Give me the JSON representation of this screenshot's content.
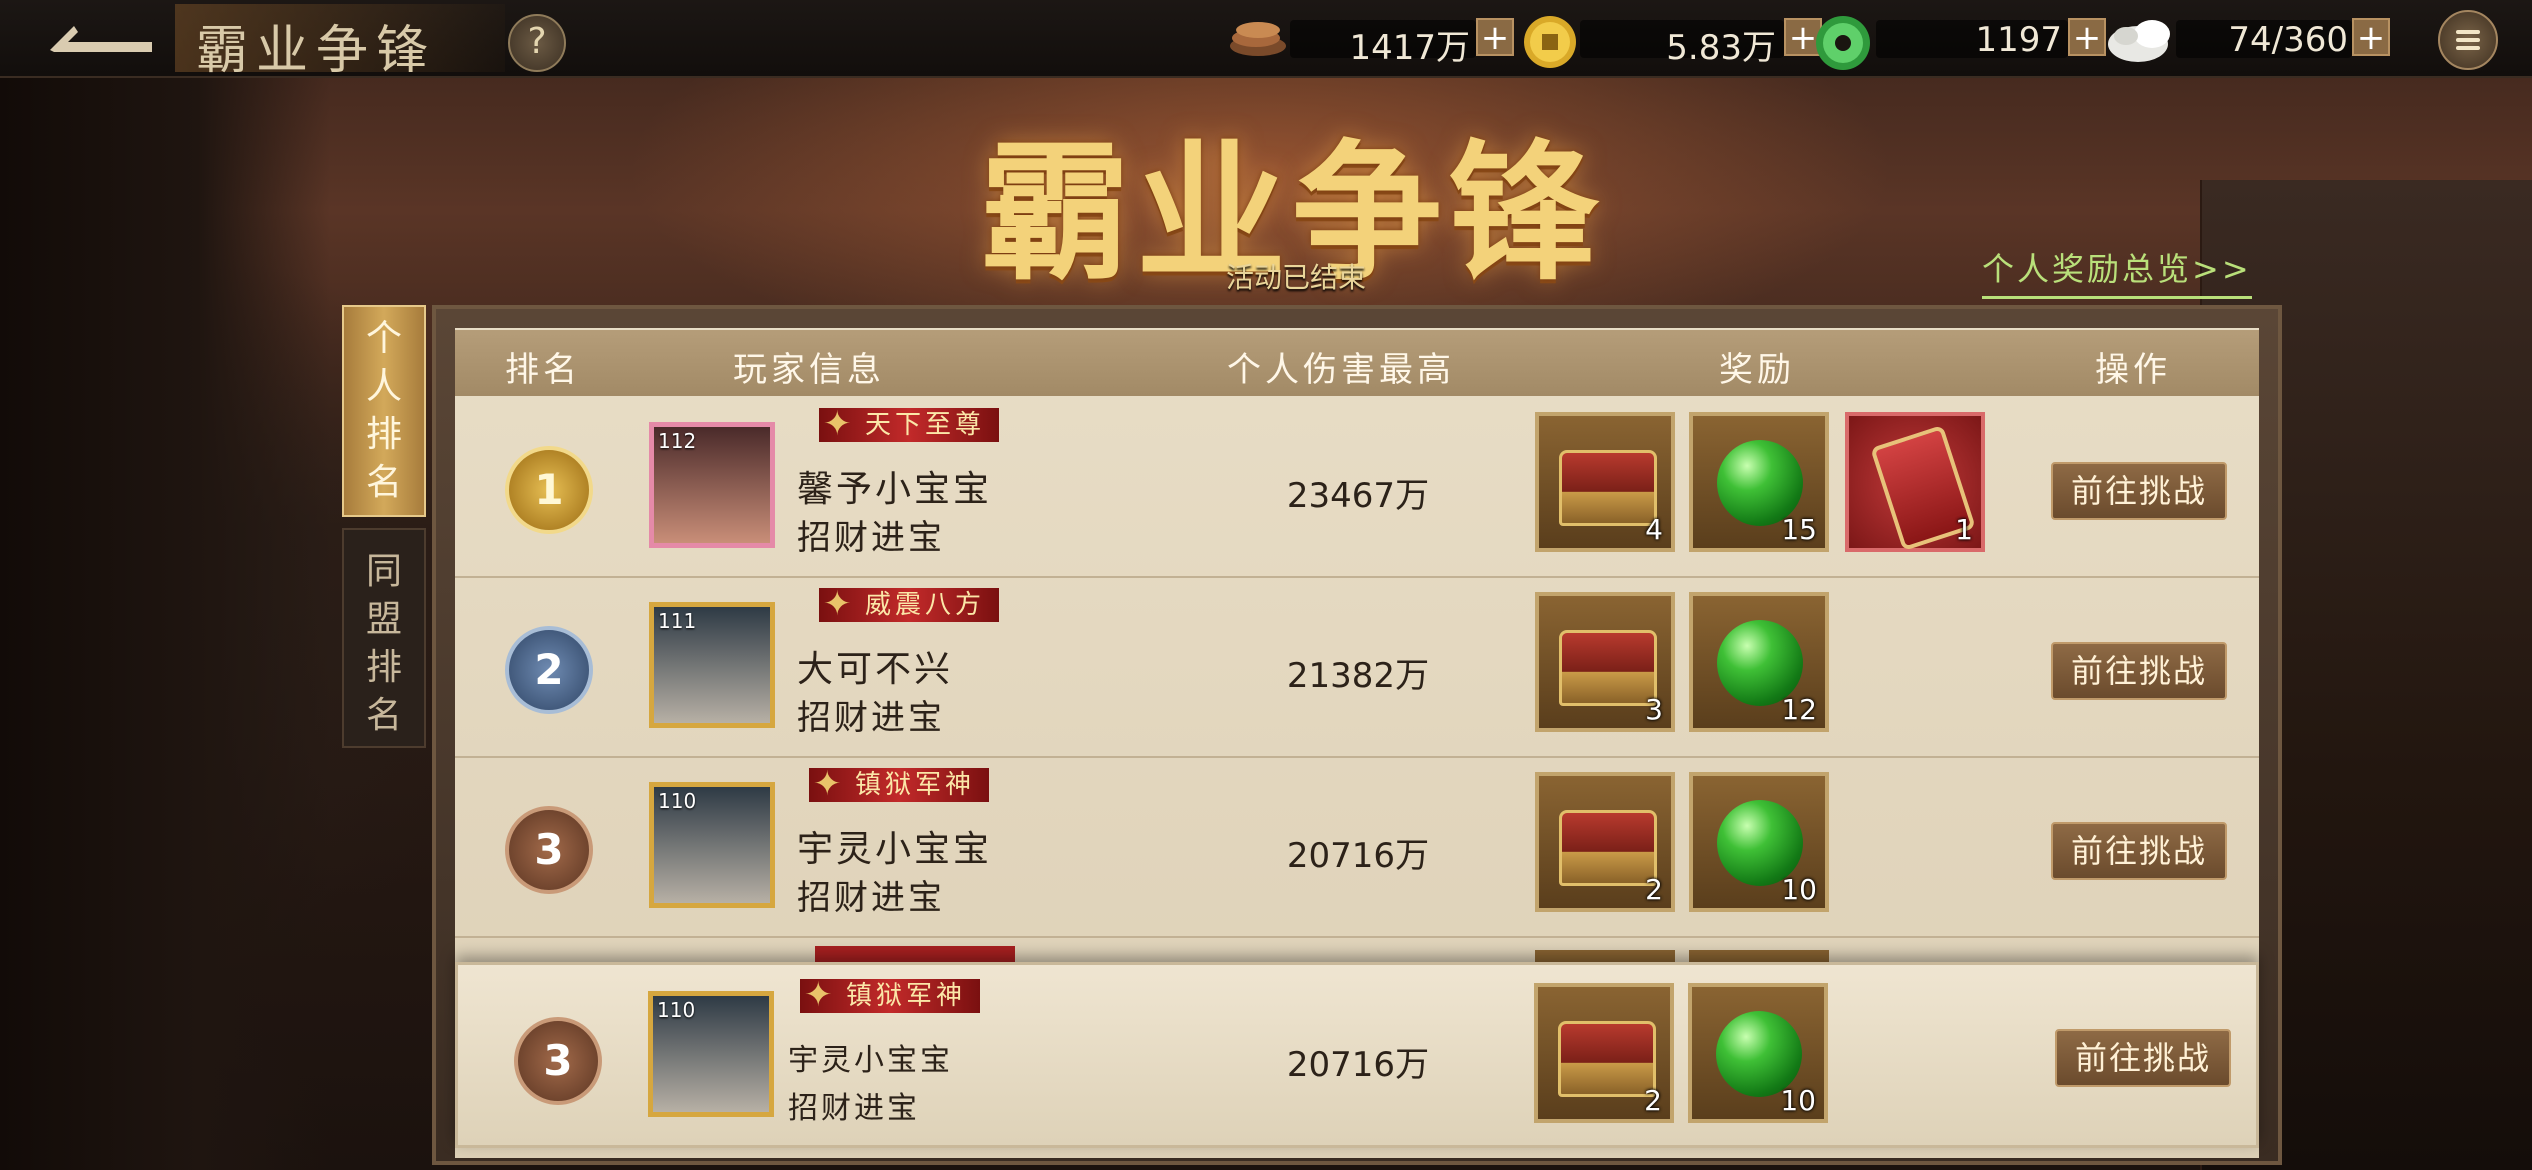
{
  "header": {
    "page_title": "霸业争锋",
    "help_label": "?",
    "big_title": "霸业争锋",
    "status": "活动已结束",
    "overview_link": "个人奖励总览>>"
  },
  "resources": [
    {
      "icon": "copper-coin-icon",
      "value": "1417万",
      "plus": "+"
    },
    {
      "icon": "gold-coin-icon",
      "value": "5.83万",
      "plus": "+"
    },
    {
      "icon": "jade-icon",
      "value": "1197",
      "plus": "+"
    },
    {
      "icon": "rice-icon",
      "value": "74/360",
      "plus": "+"
    }
  ],
  "tabs": [
    {
      "label": [
        "个",
        "人",
        "排",
        "名"
      ],
      "active": true
    },
    {
      "label": [
        "同",
        "盟",
        "排",
        "名"
      ],
      "active": false
    }
  ],
  "table": {
    "headers": [
      "排名",
      "玩家信息",
      "个人伤害最高",
      "奖励",
      "操作"
    ],
    "rows": [
      {
        "rank": "1",
        "level": "112",
        "title": "天下至尊",
        "name": "馨予小宝宝",
        "guild": "招财进宝",
        "damage": "23467万",
        "rewards": [
          {
            "type": "chest",
            "count": "4"
          },
          {
            "type": "jade-orb",
            "count": "15"
          },
          {
            "type": "token",
            "count": "1"
          }
        ],
        "action": "前往挑战"
      },
      {
        "rank": "2",
        "level": "111",
        "title": "威震八方",
        "name": "大可不兴",
        "guild": "招财进宝",
        "damage": "21382万",
        "rewards": [
          {
            "type": "chest",
            "count": "3"
          },
          {
            "type": "jade-orb",
            "count": "12"
          }
        ],
        "action": "前往挑战"
      },
      {
        "rank": "3",
        "level": "110",
        "title": "镇狱军神",
        "name": "宇灵小宝宝",
        "guild": "招财进宝",
        "damage": "20716万",
        "rewards": [
          {
            "type": "chest",
            "count": "2"
          },
          {
            "type": "jade-orb",
            "count": "10"
          }
        ],
        "action": "前往挑战"
      }
    ],
    "self_row": {
      "rank": "3",
      "level": "110",
      "title": "镇狱军神",
      "name": "宇灵小宝宝",
      "guild": "招财进宝",
      "damage": "20716万",
      "rewards": [
        {
          "type": "chest",
          "count": "2"
        },
        {
          "type": "jade-orb",
          "count": "10"
        }
      ],
      "action": "前往挑战"
    }
  },
  "colors": {
    "accent_gold": "#f3d27a",
    "link_green": "#b9e07a",
    "banner_red": "#c22a2a"
  }
}
